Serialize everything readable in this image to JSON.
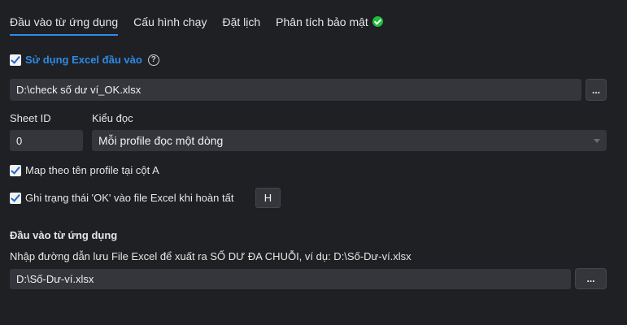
{
  "tabs": [
    {
      "label": "Đầu vào từ ứng dụng",
      "active": true
    },
    {
      "label": "Cấu hình chạy"
    },
    {
      "label": "Đặt lịch"
    },
    {
      "label": "Phân tích bảo mật",
      "status_icon": "check-circle-icon",
      "status_color": "#1fbf3a"
    }
  ],
  "excel_input": {
    "use_excel_label": "Sử dụng Excel đầu vào",
    "use_excel_checked": true,
    "help_icon": "question-circle-icon",
    "file_path": "D:\\check số dư ví_OK.xlsx",
    "browse_label": "...",
    "sheet_id_label": "Sheet ID",
    "sheet_id_value": "0",
    "read_mode_label": "Kiểu đọc",
    "read_mode_value": "Mỗi profile đọc một dòng",
    "map_profile_label": "Map theo tên profile tại cột A",
    "map_profile_checked": true,
    "write_status_label": "Ghi trạng thái 'OK' vào file Excel khi hoàn tất",
    "write_status_checked": true,
    "status_column_value": "H"
  },
  "app_input": {
    "section_title": "Đầu vào từ ứng dụng",
    "description": "Nhập đường dẫn lưu File Excel để xuất ra SỐ DƯ ĐA CHUỖI, ví dụ: D:\\Số-Dư-ví.xlsx",
    "file_path": "D:\\Số-Dư-ví.xlsx",
    "browse_label": "..."
  },
  "colors": {
    "accent": "#2e8ae6",
    "background": "#1f2024",
    "input_bg": "#34363c",
    "success": "#1fbf3a"
  }
}
